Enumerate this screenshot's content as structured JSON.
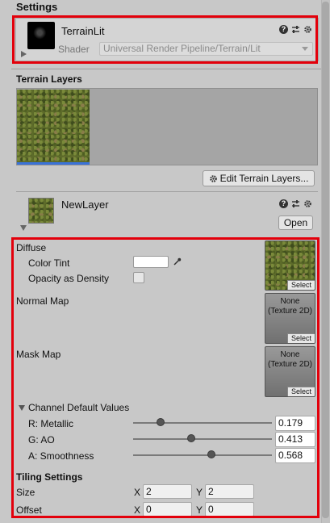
{
  "settings": {
    "title": "Settings"
  },
  "material": {
    "name": "TerrainLit",
    "shader_label": "Shader",
    "shader_value": "Universal Render Pipeline/Terrain/Lit"
  },
  "terrain_layers": {
    "title": "Terrain Layers",
    "edit_button": "Edit Terrain Layers..."
  },
  "layer": {
    "name": "NewLayer",
    "open_button": "Open"
  },
  "diffuse": {
    "label": "Diffuse",
    "color_tint_label": "Color Tint",
    "opacity_label": "Opacity as Density",
    "opacity_checked": false,
    "select": "Select"
  },
  "normal_map": {
    "label": "Normal Map",
    "none_line1": "None",
    "none_line2": "(Texture 2D)",
    "select": "Select"
  },
  "mask_map": {
    "label": "Mask Map",
    "none_line1": "None",
    "none_line2": "(Texture 2D)",
    "select": "Select"
  },
  "channel_defaults": {
    "label": "Channel Default Values",
    "metallic_label": "R: Metallic",
    "metallic_value": "0.179",
    "ao_label": "G: AO",
    "ao_value": "0.413",
    "smoothness_label": "A: Smoothness",
    "smoothness_value": "0.568"
  },
  "tiling": {
    "title": "Tiling Settings",
    "size_label": "Size",
    "offset_label": "Offset",
    "x_label": "X",
    "y_label": "Y",
    "size_x": "2",
    "size_y": "2",
    "offset_x": "0",
    "offset_y": "0"
  },
  "colors": {
    "highlight": "#e3000b",
    "panel": "#c8c8c8",
    "selection": "#3a72d8"
  }
}
